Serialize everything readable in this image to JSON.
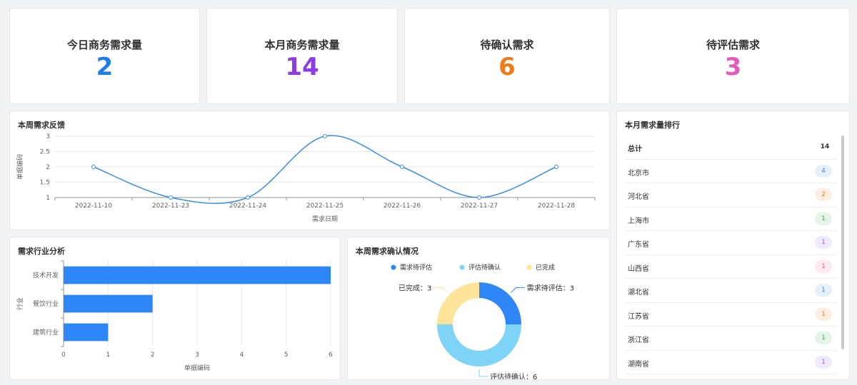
{
  "stats": [
    {
      "label": "今日商务需求量",
      "value": "2",
      "color": "#1e7ce8"
    },
    {
      "label": "本月商务需求量",
      "value": "14",
      "color": "#8b3ce6"
    },
    {
      "label": "待确认需求",
      "value": "6",
      "color": "#f07a1a"
    },
    {
      "label": "待评估需求",
      "value": "3",
      "color": "#e35ab8"
    }
  ],
  "weekly_feedback": {
    "title": "本周需求反馈",
    "chart_data": {
      "type": "line",
      "categories": [
        "2022-11-10",
        "2022-11-23",
        "2022-11-24",
        "2022-11-25",
        "2022-11-26",
        "2022-11-27",
        "2022-11-28"
      ],
      "values": [
        2,
        1,
        1,
        3,
        2,
        1,
        2
      ],
      "xlabel": "需求日期",
      "ylabel": "单据编码",
      "yticks": [
        "1",
        "1.5",
        "2",
        "2.5",
        "3"
      ],
      "ylim": [
        1,
        3
      ],
      "smooth": true,
      "color": "#3a8ee6"
    }
  },
  "industry": {
    "title": "需求行业分析",
    "chart_data": {
      "type": "bar",
      "orientation": "horizontal",
      "categories": [
        "技术开发",
        "餐饮行业",
        "建筑行业"
      ],
      "values": [
        6,
        2,
        1
      ],
      "xlabel": "单据编码",
      "ylabel": "行业",
      "xticks": [
        "0",
        "1",
        "2",
        "3",
        "4",
        "5",
        "6"
      ],
      "xlim": [
        0,
        6
      ],
      "color": "#2f86f6"
    }
  },
  "confirm": {
    "title": "本周需求确认情况",
    "chart_data": {
      "type": "pie",
      "donut": true,
      "slices": [
        {
          "name": "需求待评估",
          "value": 3,
          "color": "#2f86f6",
          "label": "需求待评估：3"
        },
        {
          "name": "评估待确认",
          "value": 6,
          "color": "#7fd3f7",
          "label": "评估待确认：6"
        },
        {
          "name": "已完成",
          "value": 3,
          "color": "#fde49a",
          "label": "已完成：3"
        }
      ],
      "legend_position": "top"
    }
  },
  "ranking": {
    "title": "本月需求量排行",
    "total_label": "总计",
    "total_value": "14",
    "items": [
      {
        "name": "北京市",
        "count": "4",
        "fg": "#3a8ee6",
        "bg": "#e6f0fc"
      },
      {
        "name": "河北省",
        "count": "2",
        "fg": "#f07a1a",
        "bg": "#fdeee2"
      },
      {
        "name": "上海市",
        "count": "1",
        "fg": "#3aa757",
        "bg": "#e5f5e9"
      },
      {
        "name": "广东省",
        "count": "1",
        "fg": "#8b5cf6",
        "bg": "#f1eafd"
      },
      {
        "name": "山西省",
        "count": "1",
        "fg": "#e35a8a",
        "bg": "#fde9ef"
      },
      {
        "name": "湖北省",
        "count": "1",
        "fg": "#3a8ee6",
        "bg": "#e6f0fc"
      },
      {
        "name": "江苏省",
        "count": "1",
        "fg": "#f07a1a",
        "bg": "#fdeee2"
      },
      {
        "name": "浙江省",
        "count": "1",
        "fg": "#3aa757",
        "bg": "#e5f5e9"
      },
      {
        "name": "湖南省",
        "count": "1",
        "fg": "#8b5cf6",
        "bg": "#f1eafd"
      }
    ]
  }
}
